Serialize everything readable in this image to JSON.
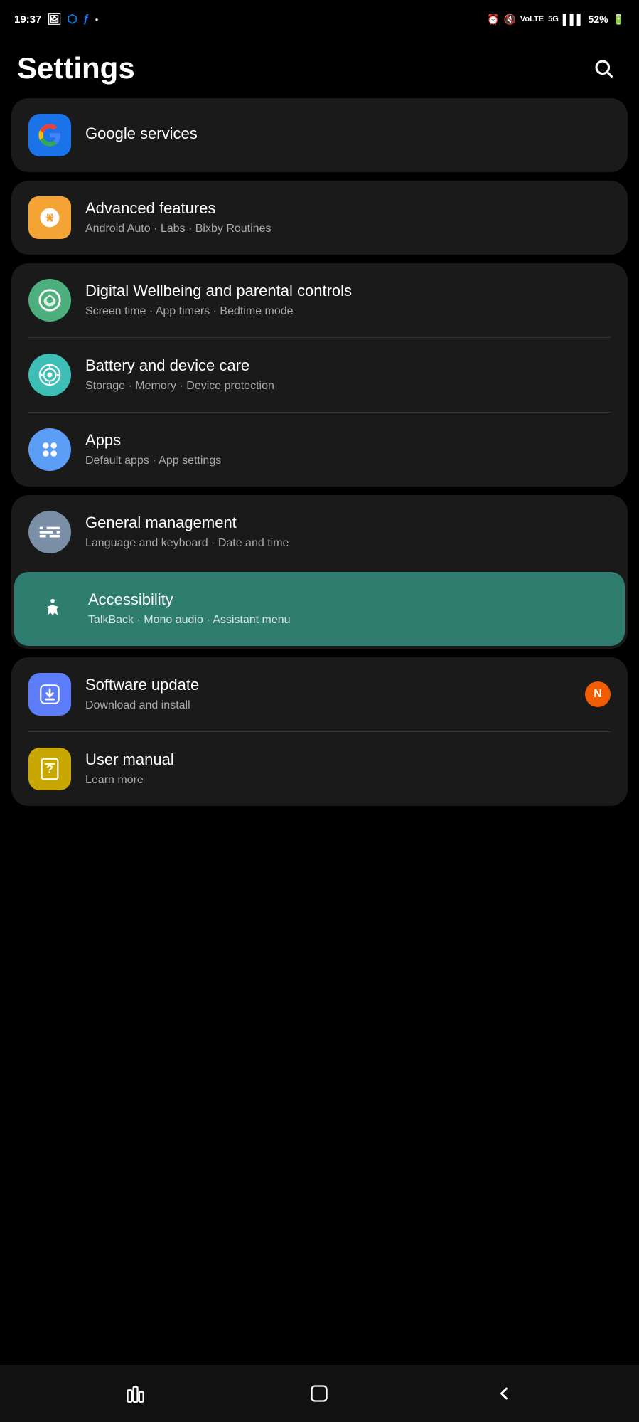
{
  "statusBar": {
    "time": "19:37",
    "battery": "52%",
    "icons": [
      "photo",
      "messenger",
      "facebook",
      "dot",
      "alarm",
      "mute",
      "volte",
      "5g",
      "signal",
      "battery"
    ]
  },
  "header": {
    "title": "Settings",
    "searchLabel": "Search"
  },
  "settingsGroups": [
    {
      "id": "group-google",
      "items": [
        {
          "id": "google-services",
          "icon": "google-icon",
          "iconBg": "google",
          "title": "Google services",
          "subtitle": "",
          "highlighted": false,
          "badge": null
        }
      ]
    },
    {
      "id": "group-advanced",
      "items": [
        {
          "id": "advanced-features",
          "icon": "advanced-icon",
          "iconBg": "advanced",
          "title": "Advanced features",
          "subtitle": "Android Auto · Labs · Bixby Routines",
          "highlighted": false,
          "badge": null
        }
      ]
    },
    {
      "id": "group-digital-battery-apps",
      "items": [
        {
          "id": "digital-wellbeing",
          "icon": "digital-wellbeing-icon",
          "iconBg": "digital",
          "title": "Digital Wellbeing and parental controls",
          "subtitle": "Screen time · App timers · Bedtime mode",
          "highlighted": false,
          "badge": null
        },
        {
          "id": "battery-care",
          "icon": "battery-icon",
          "iconBg": "battery",
          "title": "Battery and device care",
          "subtitle": "Storage · Memory · Device protection",
          "highlighted": false,
          "badge": null
        },
        {
          "id": "apps",
          "icon": "apps-icon",
          "iconBg": "apps",
          "title": "Apps",
          "subtitle": "Default apps · App settings",
          "highlighted": false,
          "badge": null
        }
      ]
    },
    {
      "id": "group-general-accessibility",
      "items": [
        {
          "id": "general-management",
          "icon": "general-icon",
          "iconBg": "general",
          "title": "General management",
          "subtitle": "Language and keyboard · Date and time",
          "highlighted": false,
          "badge": null
        },
        {
          "id": "accessibility",
          "icon": "accessibility-icon",
          "iconBg": "accessibility",
          "title": "Accessibility",
          "subtitle": "TalkBack · Mono audio · Assistant menu",
          "highlighted": true,
          "badge": null
        }
      ]
    },
    {
      "id": "group-software-manual",
      "items": [
        {
          "id": "software-update",
          "icon": "software-icon",
          "iconBg": "software",
          "title": "Software update",
          "subtitle": "Download and install",
          "highlighted": false,
          "badge": "N"
        },
        {
          "id": "user-manual",
          "icon": "manual-icon",
          "iconBg": "manual",
          "title": "User manual",
          "subtitle": "Learn more",
          "highlighted": false,
          "badge": null
        }
      ]
    }
  ],
  "navBar": {
    "recentLabel": "Recent apps",
    "homeLabel": "Home",
    "backLabel": "Back"
  }
}
